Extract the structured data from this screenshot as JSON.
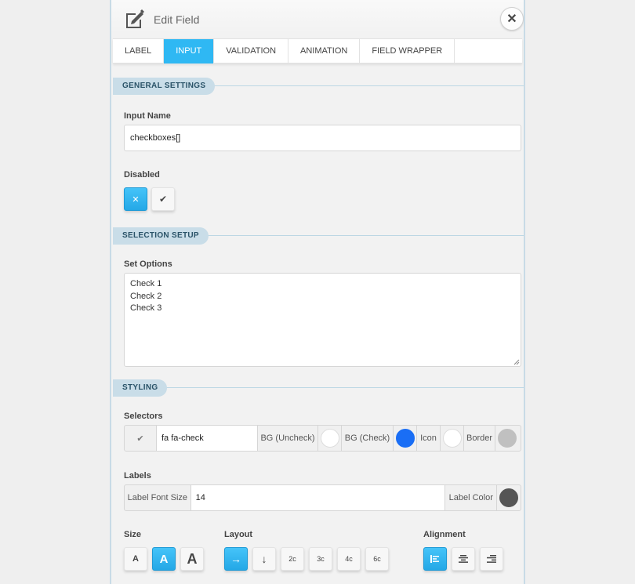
{
  "header": {
    "title": "Edit Field",
    "close_glyph": "✕",
    "edit_icon": "edit-icon"
  },
  "tabs": [
    {
      "label": "LABEL",
      "active": false
    },
    {
      "label": "INPUT",
      "active": true
    },
    {
      "label": "VALIDATION",
      "active": false
    },
    {
      "label": "ANIMATION",
      "active": false
    },
    {
      "label": "FIELD WRAPPER",
      "active": false
    }
  ],
  "general": {
    "section_title": "GENERAL SETTINGS",
    "input_name_label": "Input Name",
    "input_name_value": "checkboxes[]",
    "disabled_label": "Disabled",
    "disabled_off_glyph": "✕",
    "disabled_on_glyph": "✔"
  },
  "selection": {
    "section_title": "SELECTION SETUP",
    "options_label": "Set Options",
    "options": [
      "Check 1",
      "Check 2",
      "Check 3"
    ]
  },
  "styling": {
    "section_title": "STYLING",
    "selectors_label": "Selectors",
    "check_glyph": "✔",
    "icon_class_value": "fa fa-check",
    "bg_uncheck_label": "BG (Uncheck)",
    "bg_check_label": "BG (Check)",
    "icon_label": "Icon",
    "border_label": "Border",
    "colors": {
      "bg_uncheck": "#ffffff",
      "bg_check": "#1a6ef5",
      "icon": "#ffffff",
      "border": "#c0c0c0",
      "label_color": "#555555",
      "accent": "#2fb8f3"
    },
    "labels_label": "Labels",
    "label_font_size_label": "Label Font Size",
    "label_font_size_value": "14",
    "label_color_label": "Label Color"
  },
  "size": {
    "label": "Size",
    "options": [
      "A",
      "A",
      "A"
    ],
    "active_index": 1
  },
  "layout": {
    "label": "Layout",
    "options": [
      "→",
      "↓",
      "2c",
      "3c",
      "4c",
      "6c"
    ],
    "active_index": 0
  },
  "alignment": {
    "label": "Alignment",
    "options": [
      "align-left-icon",
      "align-center-icon",
      "align-right-icon"
    ],
    "active_index": 0
  }
}
